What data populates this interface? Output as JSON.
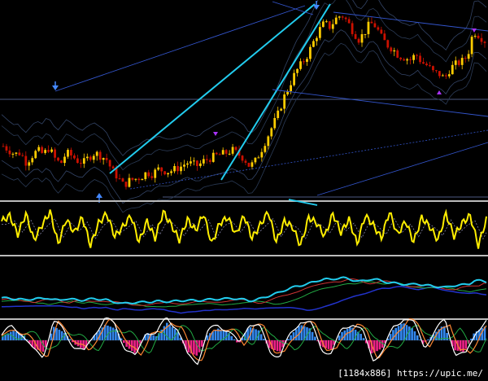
{
  "watermark": "[1184x886] https://upic.me/",
  "colors": {
    "background": "#000000",
    "bull_candle": "#ffcc00",
    "bear_candle": "#cc1100",
    "trendline": "#22ccee",
    "channel": "#3344aa",
    "separator": "#bbbbbb",
    "oscillator": "#ffee00",
    "macd_line": "#22ccee",
    "hist_up": "#3388ee",
    "hist_down": "#ee2288",
    "arrow_high": "#4488ff",
    "arrow_low": "#aa33ff"
  },
  "chart_data": {
    "type": "candlestick-with-indicators",
    "price_trace": [
      60,
      55,
      50,
      52,
      40,
      48,
      55,
      50,
      58,
      45,
      38,
      52,
      48,
      42,
      40,
      47,
      52,
      48,
      44,
      30,
      22,
      12,
      18,
      20,
      22,
      28,
      26,
      32,
      30,
      29,
      32,
      35,
      40,
      38,
      36,
      42,
      45,
      48,
      50,
      52,
      55,
      50,
      45,
      35,
      42,
      55,
      70,
      85,
      100,
      120,
      135,
      150,
      160,
      170,
      185,
      200,
      210,
      205,
      215,
      220,
      212,
      200,
      190,
      198,
      210,
      206,
      192,
      183,
      178,
      170,
      168,
      165,
      172,
      162,
      158,
      150,
      148,
      142,
      155,
      160,
      163,
      170,
      200,
      195,
      188
    ],
    "oscillator_trace": [
      0.4,
      0.7,
      -0.3,
      0.8,
      -0.6,
      0.2,
      0.9,
      -0.8,
      0.5,
      -0.2,
      0.6,
      -0.9,
      0.3,
      0.8,
      -0.4,
      0.1,
      0.7,
      -0.7,
      0.4,
      -0.5,
      0.9,
      0.2,
      -0.6,
      0.5,
      -0.1,
      0.8,
      -0.8,
      0.3,
      0.6,
      -0.3,
      0.7,
      -0.5,
      0.2,
      0.9,
      -0.7,
      0.4,
      0.1,
      -0.9,
      0.6,
      0.3,
      -0.4,
      0.8,
      -0.2,
      0.5,
      -0.8,
      0.7,
      0.2,
      -0.5,
      0.9,
      -0.3,
      0.4,
      -0.7,
      0.6,
      0.1,
      -0.6,
      0.8,
      -0.4,
      0.3,
      0.7,
      -0.9,
      0.5
    ],
    "histogram_trace": [
      0.2,
      0.5,
      0.3,
      -0.4,
      -0.6,
      0.7,
      0.4,
      -0.2,
      -0.5,
      0.3,
      0.8,
      0.6,
      -0.3,
      -0.7,
      0.4,
      0.2,
      0.9,
      0.5,
      -0.6,
      -0.8,
      0.3,
      0.6,
      0.4,
      -0.2,
      0.7,
      0.5,
      -0.4,
      -0.6,
      0.2,
      0.8,
      0.6,
      -0.3,
      -0.5,
      0.4,
      0.7,
      0.3,
      -0.7,
      -0.4,
      0.5,
      0.9,
      0.6,
      -0.2,
      0.3,
      0.8,
      -0.5,
      -0.6,
      0.4,
      0.7
    ]
  }
}
